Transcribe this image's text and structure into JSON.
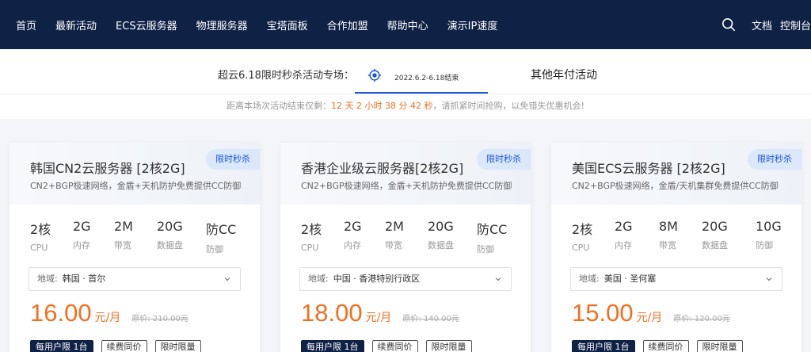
{
  "nav": {
    "items": [
      "首页",
      "最新活动",
      "ECS云服务器",
      "物理服务器",
      "宝塔面板",
      "合作加盟",
      "帮助中心",
      "演示IP速度"
    ],
    "right": [
      "文档",
      "控制台"
    ]
  },
  "promo": {
    "label": "超云6.18限时秒杀活动专场：",
    "active_date": "2022.6.2-6.18结束",
    "other": "其他年付活动"
  },
  "countdown": {
    "prefix": "距离本场次活动结束仅剩：",
    "time": "12 天 2 小时 38 分 42 秒",
    "suffix": "，请抓紧时间抢购，以免错失优惠机会!"
  },
  "colors": {
    "nav_bg": "#0f2246",
    "accent": "#1a57d6",
    "price": "#f36f20"
  },
  "cards": [
    {
      "title": "韩国CN2云服务器 [2核2G]",
      "desc": "CN2+BGP极速网络，金盾+天机防护免费提供CC防御",
      "badge": "限时秒杀",
      "specs": [
        {
          "v": "2核",
          "k": "CPU"
        },
        {
          "v": "2G",
          "k": "内存"
        },
        {
          "v": "2M",
          "k": "带宽"
        },
        {
          "v": "20G",
          "k": "数据盘"
        },
        {
          "v": "防CC",
          "k": "防御"
        }
      ],
      "region_label": "地域:",
      "region_value": "韩国 · 首尔",
      "price": "16.00",
      "unit": "元/月",
      "orig": "原价: 210.00元",
      "tags": [
        "每用户限 1台",
        "续费同价",
        "限时限量"
      ]
    },
    {
      "title": "香港企业级云服务器[2核2G]",
      "desc": "CN2+BGP极速网络，金盾+天机防护免费提供CC防御",
      "badge": "限时秒杀",
      "specs": [
        {
          "v": "2核",
          "k": "CPU"
        },
        {
          "v": "2G",
          "k": "内存"
        },
        {
          "v": "2M",
          "k": "带宽"
        },
        {
          "v": "20G",
          "k": "数据盘"
        },
        {
          "v": "防CC",
          "k": "防御"
        }
      ],
      "region_label": "地域:",
      "region_value": "中国 · 香港特别行政区",
      "price": "18.00",
      "unit": "元/月",
      "orig": "原价: 140.00元",
      "tags": [
        "每用户限 1台",
        "续费同价",
        "限时限量"
      ]
    },
    {
      "title": "美国ECS云服务器 [2核2G]",
      "desc": "CN2+BGP极速网络，金盾/天机集群免费提供CC防御",
      "badge": "限时秒杀",
      "specs": [
        {
          "v": "2核",
          "k": "CPU"
        },
        {
          "v": "2G",
          "k": "内存"
        },
        {
          "v": "8M",
          "k": "带宽"
        },
        {
          "v": "20G",
          "k": "数据盘"
        },
        {
          "v": "10G",
          "k": "防御"
        }
      ],
      "region_label": "地域:",
      "region_value": "美国 · 圣何塞",
      "price": "15.00",
      "unit": "元/月",
      "orig": "原价: 120.00元",
      "tags": [
        "每用户限 1台",
        "续费同价",
        "限时限量"
      ]
    }
  ]
}
